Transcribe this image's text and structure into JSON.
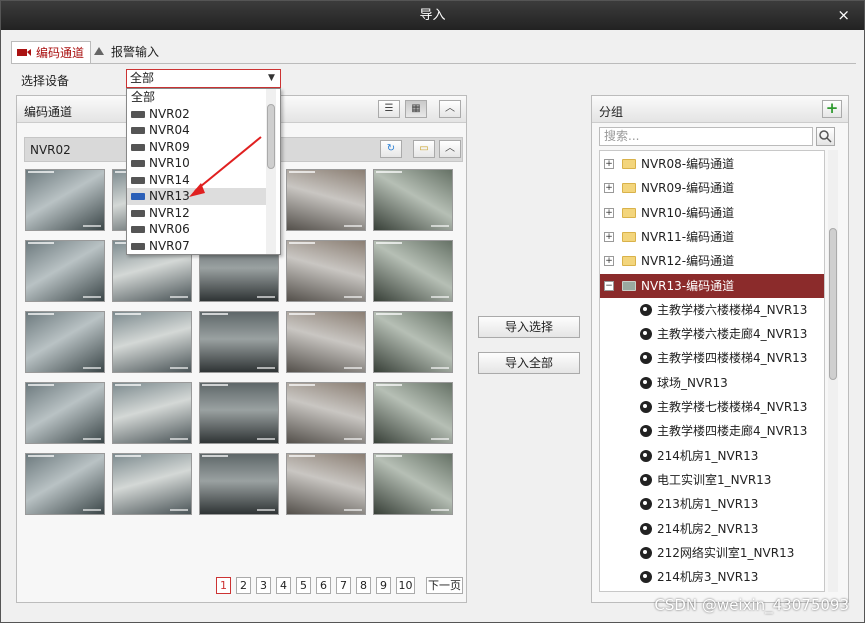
{
  "window": {
    "title": "导入",
    "close": "×"
  },
  "tabs": [
    {
      "label": "编码通道",
      "active": true
    },
    {
      "label": "报警输入",
      "active": false
    }
  ],
  "device_select": {
    "label": "选择设备",
    "value": "全部",
    "options": [
      "全部",
      "NVR02",
      "NVR04",
      "NVR09",
      "NVR10",
      "NVR14",
      "NVR13",
      "NVR12",
      "NVR06",
      "NVR07"
    ],
    "highlighted": "NVR13"
  },
  "left_panel": {
    "title": "编码通道",
    "current_device": "NVR02"
  },
  "pagination": {
    "pages": [
      "1",
      "2",
      "3",
      "4",
      "5",
      "6",
      "7",
      "8",
      "9",
      "10"
    ],
    "current": "1",
    "next": "下一页"
  },
  "actions": {
    "import_selected": "导入选择",
    "import_all": "导入全部"
  },
  "right_panel": {
    "title": "分组",
    "search_placeholder": "搜索...",
    "groups": [
      {
        "label": "NVR08-编码通道",
        "expanded": false
      },
      {
        "label": "NVR09-编码通道",
        "expanded": false
      },
      {
        "label": "NVR10-编码通道",
        "expanded": false
      },
      {
        "label": "NVR11-编码通道",
        "expanded": false
      },
      {
        "label": "NVR12-编码通道",
        "expanded": false
      },
      {
        "label": "NVR13-编码通道",
        "expanded": true,
        "selected": true
      }
    ],
    "channels": [
      "主教学楼六楼楼梯4_NVR13",
      "主教学楼六楼走廊4_NVR13",
      "主教学楼四楼楼梯4_NVR13",
      "球场_NVR13",
      "主教学楼七楼楼梯4_NVR13",
      "主教学楼四楼走廊4_NVR13",
      "214机房1_NVR13",
      "电工实训室1_NVR13",
      "213机房1_NVR13",
      "214机房2_NVR13",
      "212网络实训室1_NVR13",
      "214机房3_NVR13"
    ]
  },
  "colors": {
    "accent": "#c33333",
    "selected_row": "#8b2b2b",
    "titlebar": "#2d2d2d"
  },
  "watermark": "CSDN @weixin_43075093"
}
